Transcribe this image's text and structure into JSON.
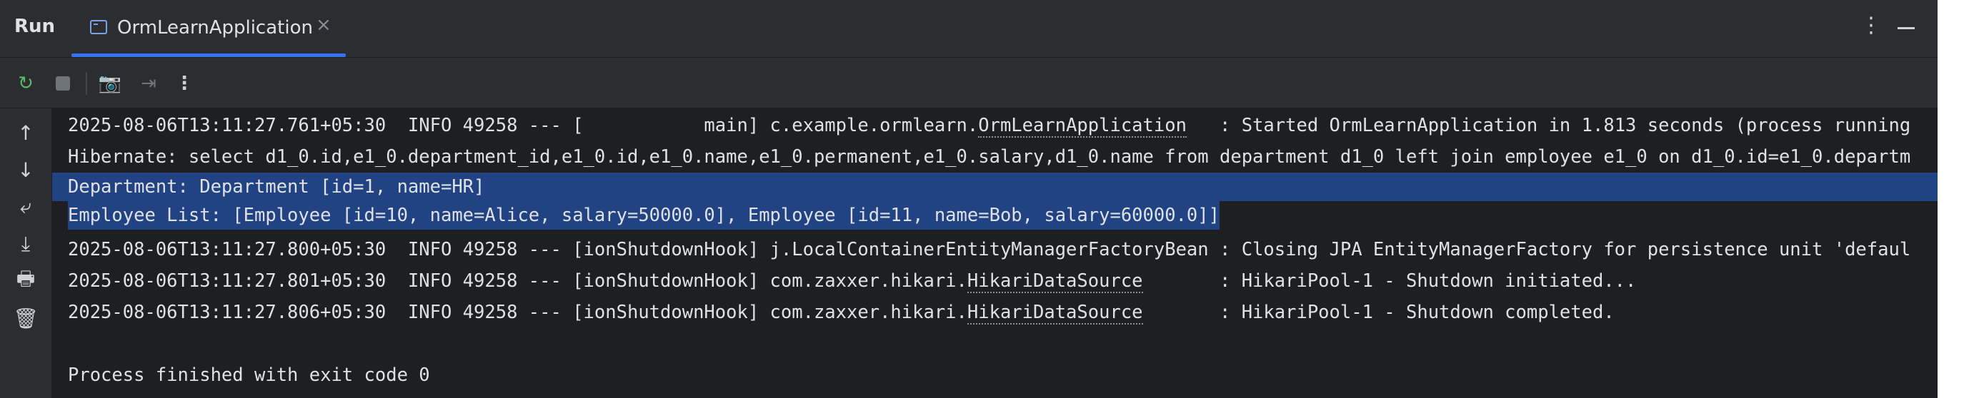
{
  "header": {
    "run_label": "Run",
    "tab_label": "OrmLearnApplication",
    "tab_close": "×",
    "more_icon": "⋮"
  },
  "toolbar": {
    "rerun_icon": "↻",
    "camera_icon": "📷",
    "exit_icon": "⇥",
    "more_icon": "⋮"
  },
  "sidebar": {
    "up_icon": "↑",
    "down_icon": "↓",
    "wrap_icon": "⤶",
    "scroll_end_icon": "⤓",
    "print_icon": "🖶",
    "trash_icon": "🗑"
  },
  "console": {
    "lines": [
      {
        "pre": "2025-08-06T13:11:27.761+05:30  INFO 49258 --- [           main] c.example.ormlearn.",
        "link": "OrmLearnApplication",
        "post": "   : Started OrmLearnApplication in 1.813 seconds (process running"
      },
      {
        "text": "Hibernate: select d1_0.id,e1_0.department_id,e1_0.id,e1_0.name,e1_0.permanent,e1_0.salary,d1_0.name from department d1_0 left join employee e1_0 on d1_0.id=e1_0.departm"
      },
      {
        "text": "Department: Department [id=1, name=HR]"
      },
      {
        "text": "Employee List: [Employee [id=10, name=Alice, salary=50000.0], Employee [id=11, name=Bob, salary=60000.0]]"
      },
      {
        "text": "2025-08-06T13:11:27.800+05:30  INFO 49258 --- [ionShutdownHook] j.LocalContainerEntityManagerFactoryBean : Closing JPA EntityManagerFactory for persistence unit 'defaul"
      },
      {
        "pre": "2025-08-06T13:11:27.801+05:30  INFO 49258 --- [ionShutdownHook] com.zaxxer.hikari.",
        "link": "HikariDataSource",
        "post": "       : HikariPool-1 - Shutdown initiated..."
      },
      {
        "pre": "2025-08-06T13:11:27.806+05:30  INFO 49258 --- [ionShutdownHook] com.zaxxer.hikari.",
        "link": "HikariDataSource",
        "post": "       : HikariPool-1 - Shutdown completed."
      },
      {
        "text": "Process finished with exit code 0"
      }
    ]
  }
}
